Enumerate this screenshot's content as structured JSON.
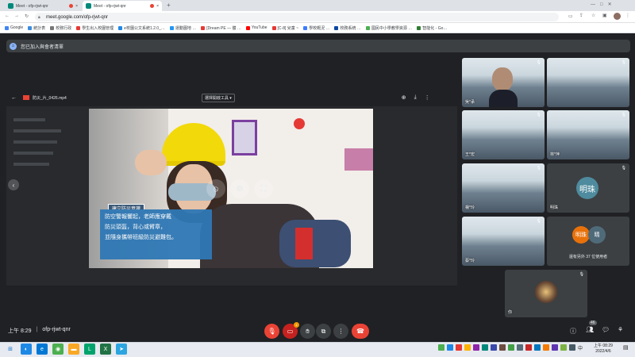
{
  "browser": {
    "tabs": [
      {
        "label": "Meet - ofp-rjwt-qnr"
      },
      {
        "label": "Meet - ofp-rjwt-qnr"
      }
    ],
    "new_tab": "+",
    "url": "meet.google.com/ofp-rjwt-qnr",
    "bookmarks": [
      {
        "label": "Google",
        "color": "#4285f4"
      },
      {
        "label": "統計表",
        "color": "#3c8cde"
      },
      {
        "label": "校務行政",
        "color": "#777777"
      },
      {
        "label": "學生出入校園管理",
        "color": "#e53935"
      },
      {
        "label": "e校園公文系統1.2.0_…",
        "color": "#1e88e5"
      },
      {
        "label": "運動園地 …",
        "color": "#2196f3"
      },
      {
        "label": "[Dream PE — 體 …",
        "color": "#e53935"
      },
      {
        "label": "YouTube",
        "color": "#ff0000"
      },
      {
        "label": "[C-8] 兒童 ~",
        "color": "#e53935"
      },
      {
        "label": "學校概況 …",
        "color": "#3d7cff"
      },
      {
        "label": "校務系統 …",
        "color": "#0d47a1"
      },
      {
        "label": "國民中小學教學資源 …",
        "color": "#4caf50"
      },
      {
        "label": "智能化 - Go…",
        "color": "#2e7d32"
      }
    ]
  },
  "meet": {
    "banner": "您已加入與會者清單",
    "presentation": {
      "file_name": "防災_片_0426.mp4",
      "viewer_label": "選擇開啟工具 ▾",
      "caption_title": "建立防災意識",
      "caption_lines": [
        "防空警報響起，老師應穿戴",
        "防災頭盔，背心或臂章，",
        "並隨身攜帶班級防災避難包。"
      ]
    },
    "participants": [
      {
        "name": "吳*承"
      },
      {
        "name": ""
      },
      {
        "name": "王*宏"
      },
      {
        "name": "林*萍"
      },
      {
        "name": "楊*玲"
      },
      {
        "name": "明珠",
        "initials": "明珠",
        "color": "#4f8b9e"
      },
      {
        "name": "蔡*玲"
      },
      {
        "name": "還有另外 37 位使用者",
        "initials": [
          "明珠",
          "晴"
        ],
        "colors": [
          "#e8710a",
          "#4f6b7a"
        ]
      },
      {
        "name": "你"
      }
    ],
    "time": "上午 8:29",
    "meeting_code": "ofp-rjwt-qnr",
    "people_count": "46",
    "hand_badge": "1"
  },
  "taskbar": {
    "clock_time": "上午 08:29",
    "clock_date": "2022/4/6",
    "lang": "中"
  }
}
